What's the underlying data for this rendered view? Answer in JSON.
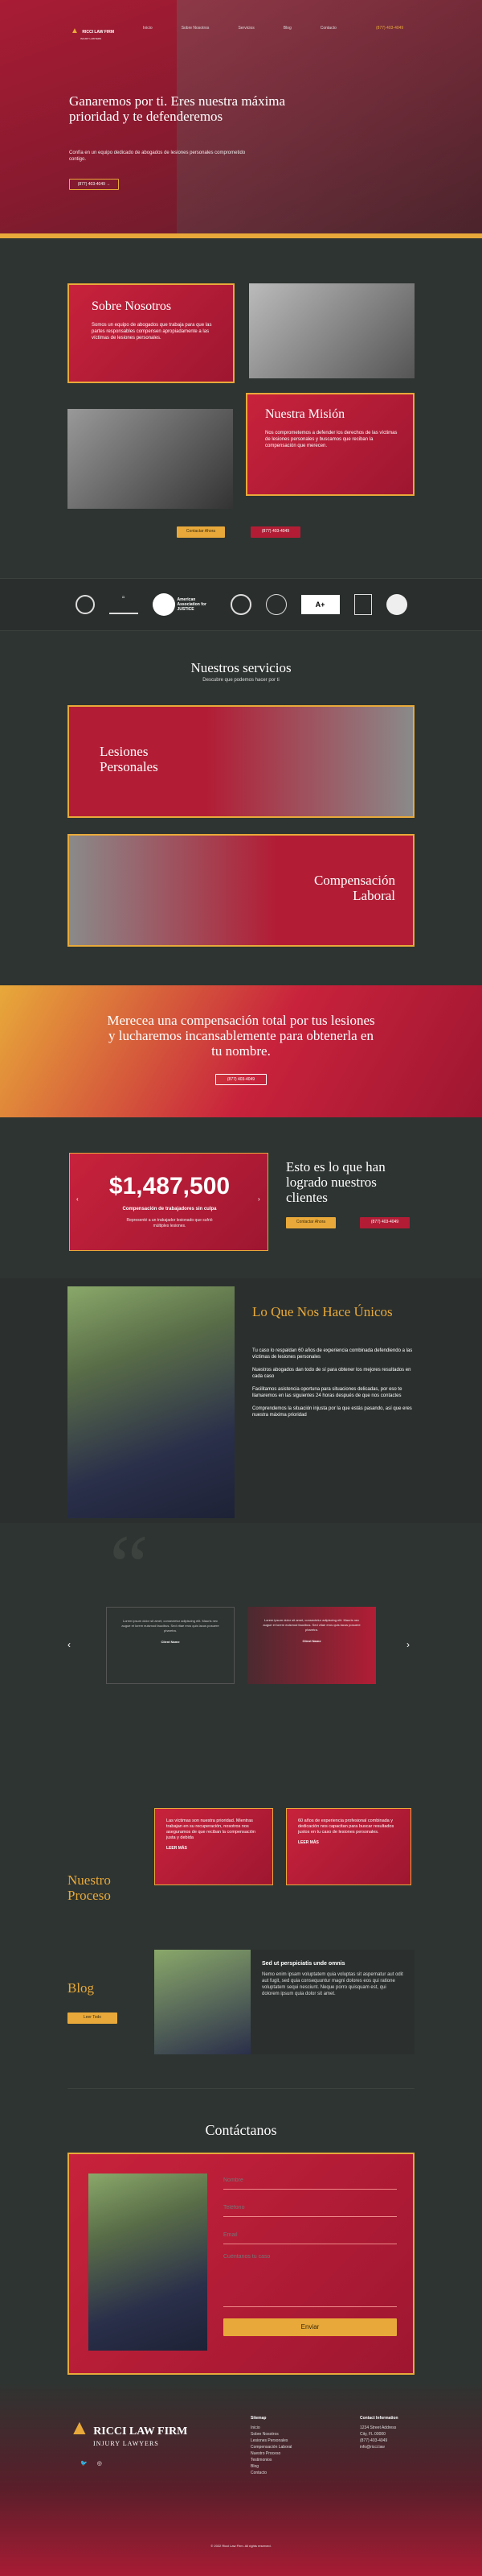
{
  "header": {
    "logo_name": "RICCI LAW FIRM",
    "logo_sub": "INJURY LAWYERS",
    "nav": [
      "Inicio",
      "Sobre Nosotros",
      "Servicios",
      "Blog",
      "Contacto"
    ],
    "phone": "(877) 403-4049"
  },
  "hero": {
    "title": "Ganaremos por ti. Eres nuestra máxima prioridad y te defenderemos",
    "text": "Confía en un equipo dedicado de abogados de lesiones personales comprometido contigo.",
    "phone_btn": "(877) 403-4049"
  },
  "about": {
    "title": "Sobre Nosotros",
    "text": "Somos un equipo de abogados que trabaja para que las partes responsables compensen apropiadamente a las víctimas de lesiones personales.",
    "mission_title": "Nuestra Misión",
    "mission_text": "Nos comprometemos a defender los derechos de las víctimas de lesiones personales y buscamos que reciban la compensación que merecen.",
    "btn1": "Contactar Ahora",
    "btn2": "(877) 403-4049"
  },
  "badges": [
    "Award",
    "Million Dollar",
    "American Association for JUSTICE",
    "Seal",
    "Super Lawyers",
    "BBB A+ Rating",
    "Top 100",
    "Badge"
  ],
  "services": {
    "title": "Nuestros servicios",
    "subtitle": "Descubre que podemos hacer por ti",
    "items": [
      "Lesiones Personales",
      "Compensación Laboral"
    ]
  },
  "banner": {
    "title": "Merecea una compensación total por tus lesiones y lucharemos incansablemente para obtenerla en tu nombre.",
    "btn": "(877) 403-4049"
  },
  "results": {
    "amount": "$1,487,500",
    "label": "Compensación de trabajadores sin culpa",
    "desc": "Representé a un trabajador lesionado que sufrió múltiples lesiones.",
    "title": "Esto es lo que han logrado nuestros clientes",
    "btn1": "Contactar Ahora",
    "btn2": "(877) 403-4049"
  },
  "unique": {
    "title": "Lo Que Nos Hace Únicos",
    "paragraphs": [
      "Tu caso lo respaldan 60 años de experiencia combinada defendiendo a las víctimas de lesiones personales",
      "Nuestros abogados dan todo de sí para obtener los mejores resultados en cada caso",
      "Facilitamos asistencia oportuna para situaciones delicadas, por eso te llamaremos en las siguientes 24 horas después de que nos contactes",
      "Comprendemos la situación injusta por la que estás pasando, así que eres nuestra máxima prioridad"
    ]
  },
  "testimonials": {
    "items": [
      {
        "text": "Lorem ipsum dolor sit amet, consectetur adipiscing elit. Mauris nec augue et lorem euismod faucibus. Sed vitae eros quis lacus posuere pharetra.",
        "name": "Client Name"
      },
      {
        "text": "Lorem ipsum dolor sit amet, consectetur adipiscing elit. Mauris nec augue et lorem euismod faucibus. Sed vitae eros quis lacus posuere pharetra.",
        "name": "Client Name"
      }
    ]
  },
  "process": {
    "title": "Nuestro Proceso",
    "cards": [
      {
        "text": "Las víctimas son nuestra prioridad. Mientras trabajan en su recuperación, nosotros nos aseguramos de que reciban la compensación justa y debida",
        "more": "LEER MÁS"
      },
      {
        "text": "60 años de experiencia profesional combinada y dedicación nos capacitan para buscar resultados justos en tu caso de lesiones personales.",
        "more": "LEER MÁS"
      }
    ]
  },
  "blog": {
    "title": "Blog",
    "btn": "Leer Todo",
    "post_title": "Sed ut perspiciatis unde omnis",
    "post_text": "Nemo enim ipsam voluptatem quia voluptas sit aspernatur aut odit aut fugit, sed quia consequuntur magni dolores eos qui ratione voluptatem sequi nesciunt. Neque porro quisquam est, qui dolorem ipsum quia dolor sit amet."
  },
  "contact": {
    "title": "Contáctanos",
    "name_ph": "Nombre",
    "phone_ph": "Teléfono",
    "email_ph": "Email",
    "msg_ph": "Cuéntanos tu caso",
    "submit": "Enviar"
  },
  "footer": {
    "logo_name": "RICCI LAW FIRM",
    "logo_sub": "INJURY LAWYERS",
    "sitemap_title": "Sitemap",
    "sitemap": [
      "Inicio",
      "Sobre Nosotros",
      "Lesiones Personales",
      "Compensación Laboral",
      "Nuestro Proceso",
      "Testimonios",
      "Blog",
      "Contacto"
    ],
    "info_title": "Contact Information",
    "info": [
      "1234 Street Address",
      "City, FL 00000",
      "(877) 403-4049",
      "info@ricci.law"
    ],
    "copyright": "© 2022 Ricci Law Firm. All rights reserved."
  },
  "colors": {
    "red": "#b21d35",
    "gold": "#e8a93a",
    "dark": "#2e3431"
  }
}
